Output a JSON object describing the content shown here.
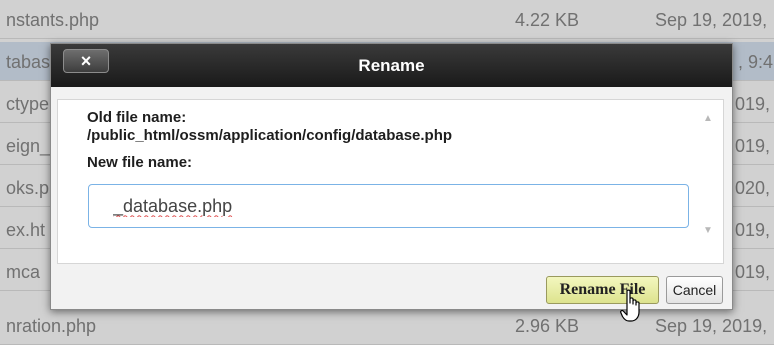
{
  "file_list": {
    "rows": [
      {
        "name": "nstants.php",
        "size": "4.22 KB",
        "date": "Sep 19, 2019,"
      },
      {
        "name": "tabas",
        "size": "",
        "date": ", 9:4"
      },
      {
        "name": "ctype",
        "size": "",
        "date": "019,"
      },
      {
        "name": "eign_",
        "size": "",
        "date": "019,"
      },
      {
        "name": "oks.p",
        "size": "",
        "date": "020,"
      },
      {
        "name": "ex.ht",
        "size": "",
        "date": "019,"
      },
      {
        "name": "mca",
        "size": "",
        "date": "019,"
      },
      {
        "name": "nration.php",
        "size": "2.96 KB",
        "date": "Sep 19, 2019,"
      }
    ]
  },
  "dialog": {
    "title": "Rename",
    "close_label": "×",
    "old_label": "Old file name:",
    "old_path": "/public_html/ossm/application/config/database.php",
    "new_label": "New file name:",
    "new_value": "_database.php",
    "rename_button": "Rename File",
    "cancel_button": "Cancel"
  },
  "colors": {
    "rename_button": "#e8ecad",
    "titlebar": "#262626",
    "input_border": "#7bb3e6"
  },
  "icons": {
    "close": "close-icon",
    "cursor": "hand-pointer-icon",
    "scroll_up": "scroll-up-arrow-icon",
    "scroll_down": "scroll-down-arrow-icon"
  }
}
